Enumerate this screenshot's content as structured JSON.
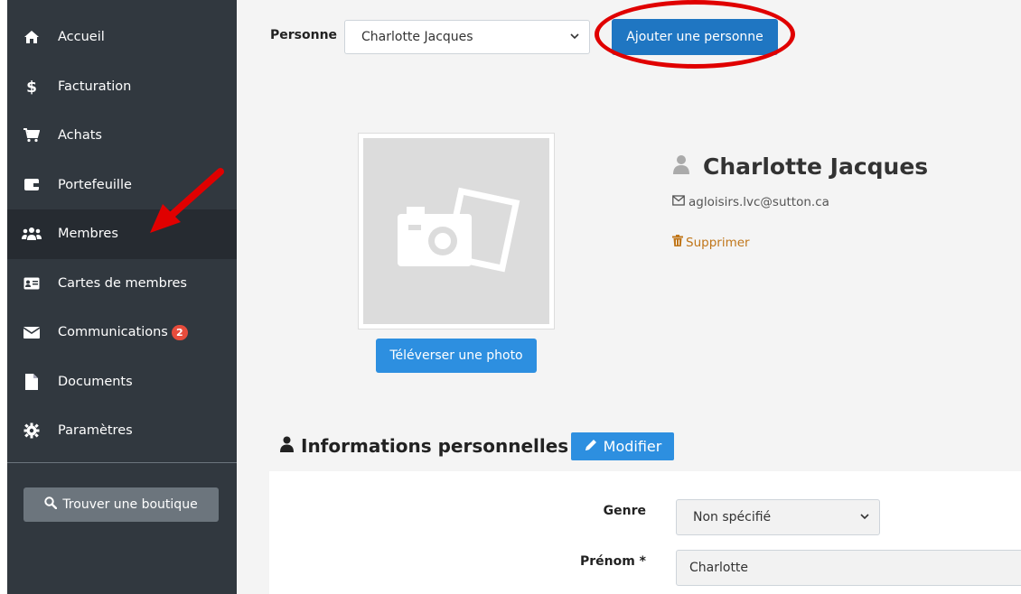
{
  "sidebar": {
    "items": [
      {
        "label": "Accueil",
        "icon": "home-icon"
      },
      {
        "label": "Facturation",
        "icon": "dollar-icon"
      },
      {
        "label": "Achats",
        "icon": "cart-icon"
      },
      {
        "label": "Portefeuille",
        "icon": "wallet-icon"
      },
      {
        "label": "Membres",
        "icon": "users-icon",
        "active": true
      },
      {
        "label": "Cartes de membres",
        "icon": "id-card-icon"
      },
      {
        "label": "Communications",
        "icon": "envelope-icon",
        "badge": "2"
      },
      {
        "label": "Documents",
        "icon": "file-icon"
      },
      {
        "label": "Paramètres",
        "icon": "gear-icon"
      }
    ],
    "shop_button": "Trouver une boutique"
  },
  "top": {
    "person_label": "Personne",
    "person_selected": "Charlotte Jacques",
    "add_button": "Ajouter une personne"
  },
  "profile": {
    "upload_button": "Téléverser une photo",
    "name": "Charlotte Jacques",
    "email": "agloisirs.lvc@sutton.ca",
    "delete_label": "Supprimer"
  },
  "section": {
    "title": "Informations personnelles",
    "edit_button": "Modifier"
  },
  "form": {
    "genre_label": "Genre",
    "genre_value": "Non spécifié",
    "prenom_label": "Prénom *",
    "prenom_value": "Charlotte"
  },
  "colors": {
    "sidebar_bg": "#31383f",
    "sidebar_active": "#262b31",
    "primary_blue": "#1f76c2",
    "light_blue": "#2d8fe0",
    "badge_red": "#e74c3c",
    "annotation_red": "#e00000",
    "delete_orange": "#c0761a"
  }
}
